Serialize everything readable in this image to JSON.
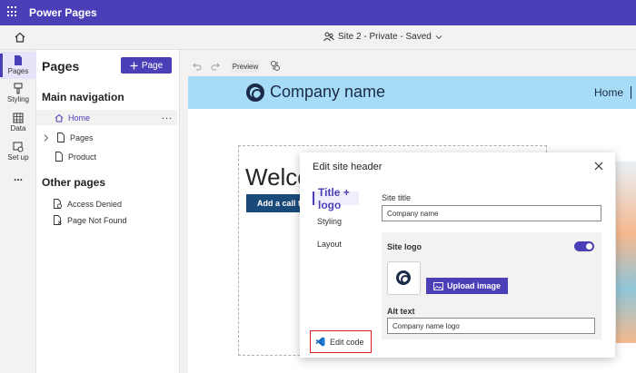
{
  "app": {
    "title": "Power Pages"
  },
  "subbar": {
    "site_status": "Site 2 - Private - Saved"
  },
  "rail": {
    "items": [
      {
        "label": "Pages",
        "icon": "page-icon"
      },
      {
        "label": "Styling",
        "icon": "brush-icon"
      },
      {
        "label": "Data",
        "icon": "table-icon"
      },
      {
        "label": "Set up",
        "icon": "setup-icon"
      },
      {
        "label": "...",
        "icon": "more-icon"
      }
    ]
  },
  "panel": {
    "title": "Pages",
    "add_button": "Page",
    "main_nav_title": "Main navigation",
    "main_nav": [
      {
        "label": "Home",
        "icon": "home-icon"
      },
      {
        "label": "Pages",
        "icon": "page-icon"
      },
      {
        "label": "Product",
        "icon": "page-icon"
      }
    ],
    "more_icon": "...",
    "other_title": "Other pages",
    "other_pages": [
      {
        "label": "Access Denied",
        "icon": "access-denied-icon"
      },
      {
        "label": "Page Not Found",
        "icon": "page-not-found-icon"
      }
    ]
  },
  "toolbar": {
    "preview": "Preview"
  },
  "site": {
    "company_name": "Company name",
    "nav_home": "Home",
    "welcome": "Welco",
    "cta": "Add a call to"
  },
  "dialog": {
    "title": "Edit site header",
    "tabs": [
      "Title + logo",
      "Styling",
      "Layout"
    ],
    "site_title_label": "Site title",
    "site_title_value": "Company name",
    "site_logo_label": "Site logo",
    "upload_button": "Upload image",
    "alt_text_label": "Alt text",
    "alt_text_value": "Company name logo",
    "edit_code": "Edit code"
  },
  "colors": {
    "brand": "#4b3fb8",
    "header_bg": "#a6dcf5",
    "cta_bg": "#1a4a7a",
    "highlight": "#e02020"
  }
}
